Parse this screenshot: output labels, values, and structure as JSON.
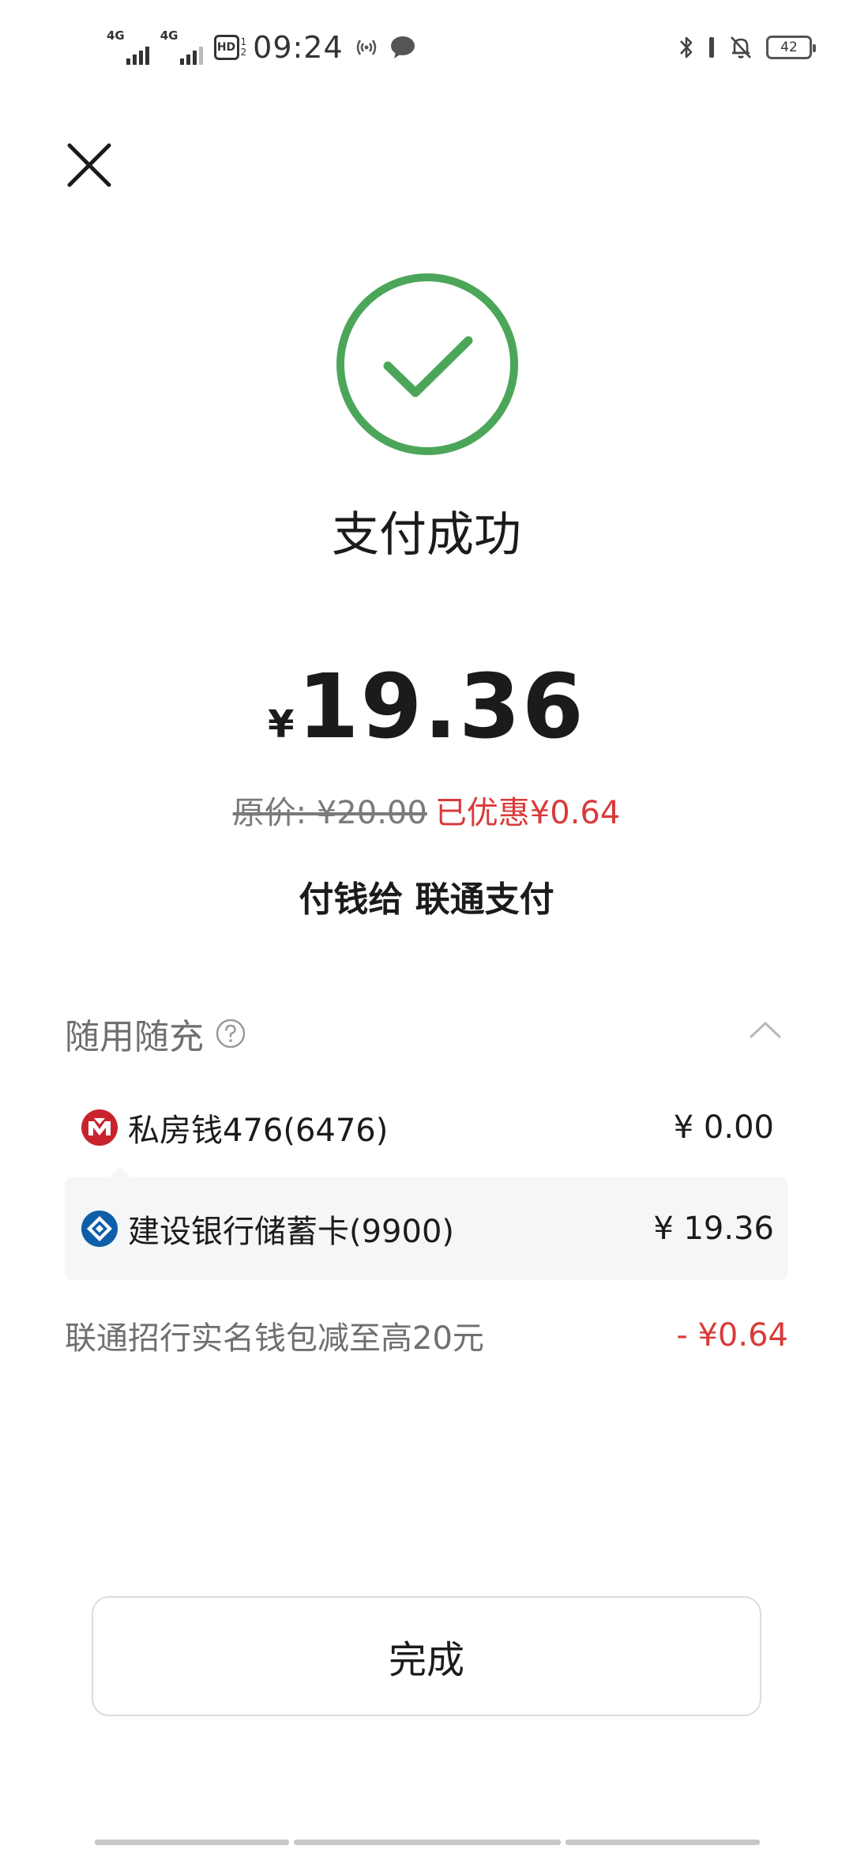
{
  "status_bar": {
    "sim1_label": "4G",
    "sim2_label": "4G",
    "hd_label": "HD",
    "hd_sub": "1\n2",
    "time": "09:24",
    "battery_level": "42",
    "icons": [
      "signal-icon",
      "hd-icon",
      "hotspot-icon",
      "chat-icon",
      "bluetooth-icon",
      "bell-off-icon",
      "battery-icon"
    ]
  },
  "header": {
    "close_icon": "close-icon"
  },
  "result": {
    "title": "支付成功",
    "currency_symbol": "¥",
    "amount": "19.36",
    "original_price": "原价: ¥20.00",
    "discount_text": "已优惠¥0.64",
    "payee": "付钱给 联通支付",
    "accent_color": "#4ca65a",
    "discount_color": "#d93a3a"
  },
  "payment_section": {
    "title": "随用随充",
    "methods": [
      {
        "label": "私房钱476(6476)",
        "amount": "¥ 0.00",
        "icon": "cmb-bank-icon"
      },
      {
        "label": "建设银行储蓄卡(9900)",
        "amount": "¥ 19.36",
        "icon": "ccb-bank-icon"
      }
    ],
    "promotion": {
      "label": "联通招行实名钱包减至高20元",
      "amount": "- ¥0.64"
    }
  },
  "footer": {
    "done_label": "完成"
  }
}
